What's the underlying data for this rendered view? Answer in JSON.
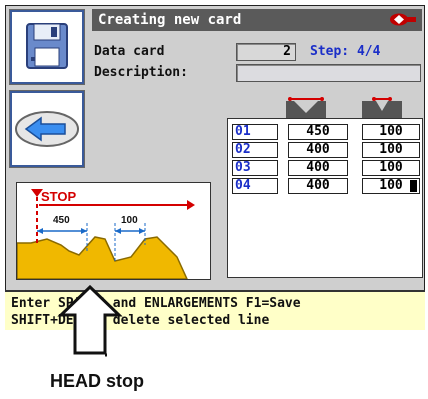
{
  "header": {
    "title": "Creating new card"
  },
  "form": {
    "data_card_label": "Data card",
    "data_card_value": "2",
    "step_text": "Step: 4/4",
    "description_label": "Description:",
    "description_value": ""
  },
  "table": {
    "rows": [
      {
        "num": "01",
        "space": "450",
        "enlargement": "100"
      },
      {
        "num": "02",
        "space": "400",
        "enlargement": "100"
      },
      {
        "num": "03",
        "space": "400",
        "enlargement": "100"
      },
      {
        "num": "04",
        "space": "400",
        "enlargement": "100"
      }
    ]
  },
  "diagram": {
    "stop_label": "STOP",
    "dim_space": "450",
    "dim_enlargement": "100"
  },
  "status": {
    "line1": "Enter SPACES and ENLARGEMENTS F1=Save",
    "line2": "SHIFT+DEL to delete selected line"
  },
  "caption": "HEAD stop",
  "icons": [
    "floppy-disk-icon",
    "back-arrow-icon",
    "brand-logo-icon",
    "space-header-icon",
    "enlargement-header-icon",
    "stop-pointer-icon"
  ],
  "colors": {
    "accent_blue": "#1a2ec8",
    "title_bar": "#5a5a5a",
    "stop_red": "#d40000",
    "status_bg": "#ffffc8",
    "diagram_key": "#f0b800"
  }
}
